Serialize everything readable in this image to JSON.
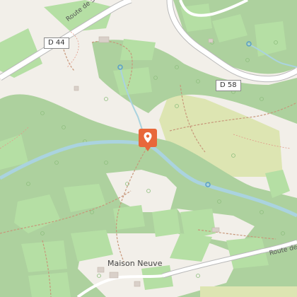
{
  "map": {
    "road_shields": [
      "D 44",
      "D 58"
    ],
    "road_labels": [
      "Route de Sérignol",
      "Route de"
    ],
    "place_labels": [
      "Maison Neuve"
    ],
    "marker": {
      "icon": "location-pin-icon",
      "color": "#e8673a"
    },
    "colors": {
      "background": "#f2efe9",
      "vineyard": "#b5dfa4",
      "forest": "#add19e",
      "grassland": "#dde5b2",
      "water": "#aad3df",
      "road": "#ffffff",
      "track": "#c7977a"
    }
  }
}
